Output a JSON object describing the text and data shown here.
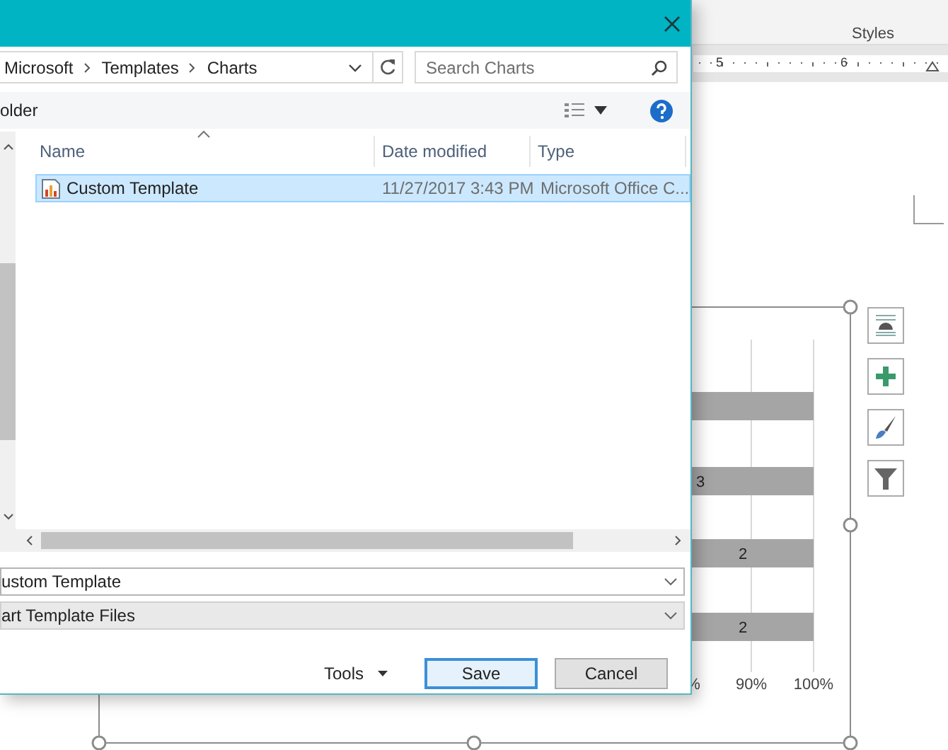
{
  "word": {
    "ribbon_group": "Styles",
    "ruler_numbers": [
      "5",
      "6"
    ],
    "chart": {
      "bar_labels": [
        "3",
        "2",
        "2"
      ],
      "axis_labels": [
        "%",
        "90%",
        "100%"
      ]
    }
  },
  "dialog": {
    "address": [
      "Microsoft",
      "Templates",
      "Charts"
    ],
    "search": {
      "placeholder": "Search Charts"
    },
    "toolbar_button": "older",
    "columns": [
      "Name",
      "Date modified",
      "Type"
    ],
    "rows": [
      {
        "name": "Custom Template",
        "date": "11/27/2017 3:43 PM",
        "type": "Microsoft Office C...",
        "selected": true
      }
    ],
    "file_name": "ustom Template",
    "save_as_type": "art Template Files",
    "tools": "Tools",
    "buttons": [
      {
        "label": "Save",
        "kind": "primary"
      },
      {
        "label": "Cancel",
        "kind": "secondary"
      }
    ]
  }
}
